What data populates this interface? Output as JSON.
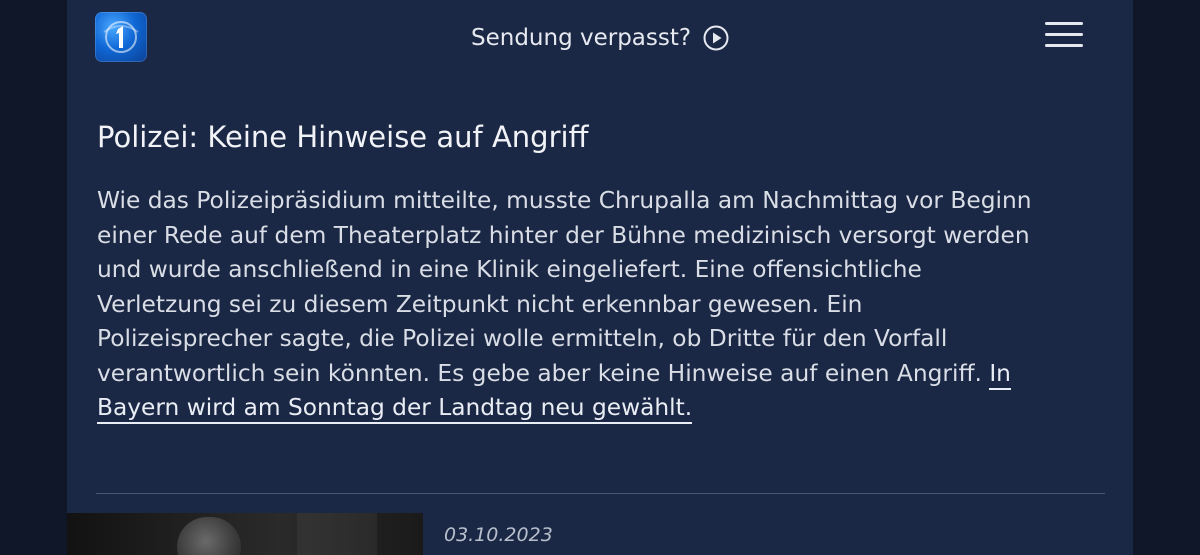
{
  "header": {
    "logo_name": "tagesschau-logo",
    "missed_broadcast_label": "Sendung verpasst?",
    "play_icon": "play-circle-icon",
    "menu_icon": "hamburger-menu-icon"
  },
  "article": {
    "headline": "Polizei: Keine Hinweise auf Angriff",
    "body_lines": [
      "Wie das Polizeipräsidium mitteilte, musste Chrupalla am Nachmittag vor Beginn",
      "einer Rede auf dem Theaterplatz hinter der Bühne medizinisch versorgt werden",
      "und wurde anschließend in eine Klinik eingeliefert. Eine offensichtliche",
      "Verletzung sei zu diesem Zeitpunkt nicht erkennbar gewesen. Ein",
      "Polizeisprecher sagte, die Polizei wolle ermitteln, ob Dritte für den Vorfall",
      "verantwortlich sein könnten. Es gebe aber keine Hinweise auf einen Angriff. "
    ],
    "link_part1": "In",
    "link_part2": "Bayern wird am Sonntag der Landtag neu gewählt."
  },
  "teaser": {
    "date": "03.10.2023"
  },
  "colors": {
    "page_bg": "#1b2845",
    "outer_bg": "#0f1729",
    "text": "#d9dde5",
    "logo_blue": "#1068d6"
  }
}
